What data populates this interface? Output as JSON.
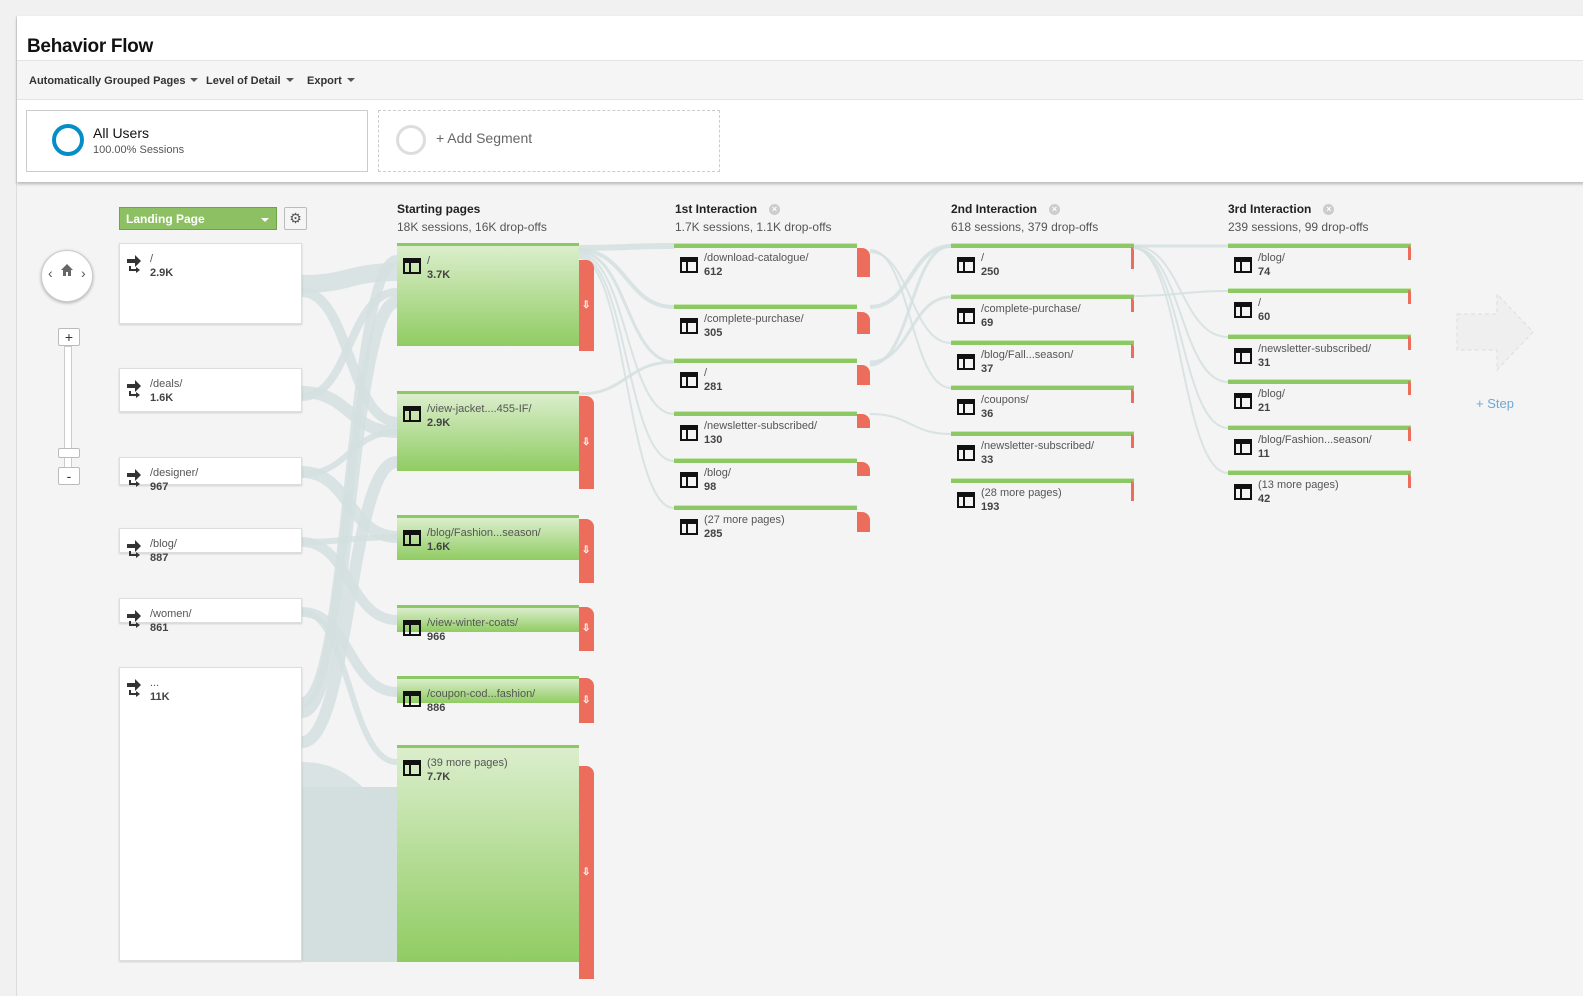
{
  "header": {
    "title": "Behavior Flow"
  },
  "toolbar": {
    "grouped": "Automatically Grouped Pages",
    "detail": "Level of Detail",
    "export": "Export"
  },
  "segments": {
    "all_users": {
      "name": "All Users",
      "sub": "100.00% Sessions"
    },
    "add": "+ Add Segment"
  },
  "controls": {
    "dimension": "Landing Page",
    "step": "+ Step"
  },
  "columns": [
    {
      "title": "Starting pages",
      "sub": "18K sessions, 16K drop-offs"
    },
    {
      "title": "1st Interaction",
      "sub": "1.7K sessions, 1.1K drop-offs"
    },
    {
      "title": "2nd Interaction",
      "sub": "618 sessions, 379 drop-offs"
    },
    {
      "title": "3rd Interaction",
      "sub": "239 sessions, 99 drop-offs"
    }
  ],
  "landing": [
    {
      "label": "/",
      "value": "2.9K"
    },
    {
      "label": "/deals/",
      "value": "1.6K"
    },
    {
      "label": "/designer/",
      "value": "967"
    },
    {
      "label": "/blog/",
      "value": "887"
    },
    {
      "label": "/women/",
      "value": "861"
    },
    {
      "label": "...",
      "value": "11K"
    }
  ],
  "starting": [
    {
      "label": "/",
      "value": "3.7K"
    },
    {
      "label": "/view-jacket....455-IF/",
      "value": "2.9K"
    },
    {
      "label": "/blog/Fashion...season/",
      "value": "1.6K"
    },
    {
      "label": "/view-winter-coats/",
      "value": "966"
    },
    {
      "label": "/coupon-cod...fashion/",
      "value": "886"
    },
    {
      "label": "(39 more pages)",
      "value": "7.7K"
    }
  ],
  "interaction1": [
    {
      "label": "/download-catalogue/",
      "value": "612"
    },
    {
      "label": "/complete-purchase/",
      "value": "305"
    },
    {
      "label": "/",
      "value": "281"
    },
    {
      "label": "/newsletter-subscribed/",
      "value": "130"
    },
    {
      "label": "/blog/",
      "value": "98"
    },
    {
      "label": "(27 more pages)",
      "value": "285"
    }
  ],
  "interaction2": [
    {
      "label": "/",
      "value": "250"
    },
    {
      "label": "/complete-purchase/",
      "value": "69"
    },
    {
      "label": "/blog/Fall...season/",
      "value": "37"
    },
    {
      "label": "/coupons/",
      "value": "36"
    },
    {
      "label": "/newsletter-subscribed/",
      "value": "33"
    },
    {
      "label": "(28 more pages)",
      "value": "193"
    }
  ],
  "interaction3": [
    {
      "label": "/blog/",
      "value": "74"
    },
    {
      "label": "/",
      "value": "60"
    },
    {
      "label": "/newsletter-subscribed/",
      "value": "31"
    },
    {
      "label": "/blog/",
      "value": "21"
    },
    {
      "label": "/blog/Fashion...season/",
      "value": "11"
    },
    {
      "label": "(13 more pages)",
      "value": "42"
    }
  ],
  "colors": {
    "node_green": "#8cc864",
    "dropoff_red": "#ec6d5b",
    "flow": "#d3dfdf",
    "segment_ring": "#058dc7",
    "link_blue": "#6ca9d6"
  },
  "icons": {
    "landing": "arrow-entry-icon",
    "page": "page-layout-icon",
    "gear": "gear-icon",
    "home": "home-icon"
  }
}
